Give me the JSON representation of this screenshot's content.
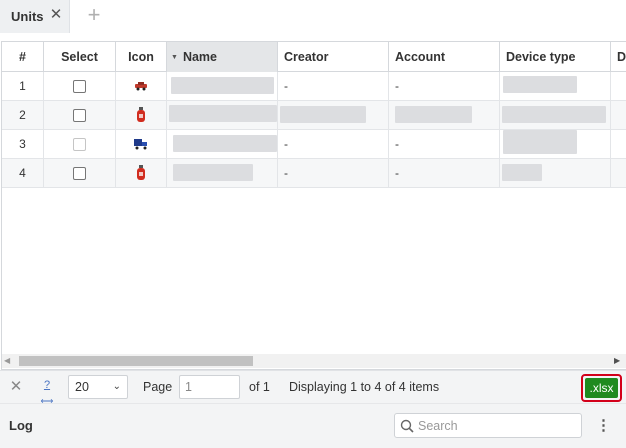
{
  "tab": {
    "label": "Units",
    "close_glyph": "✕",
    "add_glyph": "+"
  },
  "grid": {
    "columns": [
      {
        "label": "#"
      },
      {
        "label": "Select"
      },
      {
        "label": "Icon"
      },
      {
        "label": "Name",
        "sorted": "descending"
      },
      {
        "label": "Creator"
      },
      {
        "label": "Account"
      },
      {
        "label": "Device type"
      },
      {
        "label": "D"
      }
    ],
    "rows": [
      {
        "num": "1",
        "icon": "red-car-icon",
        "creator": "-",
        "account": "-",
        "checkbox_enabled": true
      },
      {
        "num": "2",
        "icon": "fire-extinguisher-icon",
        "creator": "",
        "account": "",
        "checkbox_enabled": true
      },
      {
        "num": "3",
        "icon": "blue-truck-icon",
        "creator": "-",
        "account": "-",
        "checkbox_enabled": false
      },
      {
        "num": "4",
        "icon": "fire-extinguisher-icon",
        "creator": "-",
        "account": "-",
        "checkbox_enabled": true
      }
    ]
  },
  "pager": {
    "page_size": "20",
    "page_label": "Page",
    "page_value": "1",
    "of_label": "of 1",
    "status": "Displaying 1 to 4 of 4 items",
    "export_label": ".xlsx",
    "refresh_glyph": "?"
  },
  "log": {
    "title": "Log",
    "search_placeholder": "Search"
  },
  "colors": {
    "accent_export": "#1f8a1f",
    "highlight": "#d3001a",
    "sorted_header": "#e4e6e8"
  }
}
